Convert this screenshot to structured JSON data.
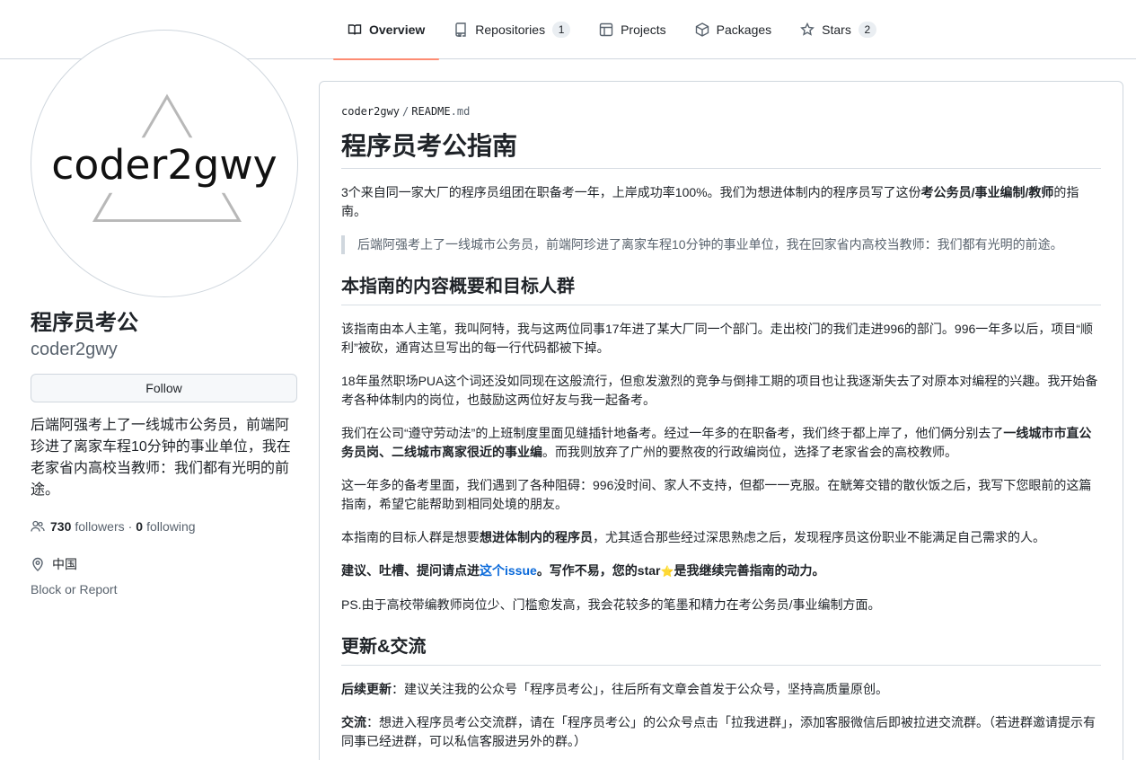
{
  "nav": {
    "tabs": [
      {
        "label": "Overview",
        "counter": ""
      },
      {
        "label": "Repositories",
        "counter": "1"
      },
      {
        "label": "Projects",
        "counter": ""
      },
      {
        "label": "Packages",
        "counter": ""
      },
      {
        "label": "Stars",
        "counter": "2"
      }
    ]
  },
  "profile": {
    "avatar_text": "coder2gwy",
    "fullname": "程序员考公",
    "username": "coder2gwy",
    "follow_label": "Follow",
    "bio": "后端阿强考上了一线城市公务员，前端阿珍进了离家车程10分钟的事业单位，我在老家省内高校当教师：我们都有光明的前途。",
    "followers_count": "730",
    "followers_label": "followers",
    "dot": "·",
    "following_count": "0",
    "following_label": "following",
    "location": "中国",
    "block_label": "Block or Report"
  },
  "readme": {
    "crumb_user": "coder2gwy",
    "crumb_sep": "/",
    "crumb_file": "README",
    "crumb_ext": ".md",
    "title": "程序员考公指南",
    "intro_a": "3个来自同一家大厂的程序员组团在职备考一年，上岸成功率100%。我们为想进体制内的程序员写了这份",
    "intro_b": "考公务员/事业编制/教师",
    "intro_c": "的指南。",
    "quote": "后端阿强考上了一线城市公务员，前端阿珍进了离家车程10分钟的事业单位，我在回家省内高校当教师：我们都有光明的前途。",
    "h2_overview": "本指南的内容概要和目标人群",
    "p1": "该指南由本人主笔，我叫阿特，我与这两位同事17年进了某大厂同一个部门。走出校门的我们走进996的部门。996一年多以后，项目“顺利”被砍，通宵达旦写出的每一行代码都被下掉。",
    "p2": "18年虽然职场PUA这个词还没如同现在这般流行，但愈发激烈的竞争与倒排工期的项目也让我逐渐失去了对原本对编程的兴趣。我开始备考各种体制内的岗位，也鼓励这两位好友与我一起备考。",
    "p3_a": "我们在公司“遵守劳动法”的上班制度里面见缝插针地备考。经过一年多的在职备考，我们终于都上岸了，他们俩分别去了",
    "p3_b": "一线城市市直公务员岗、二线城市离家很近的事业编",
    "p3_c": "。而我则放弃了广州的要熬夜的行政编岗位，选择了老家省会的高校教师。",
    "p4": "这一年多的备考里面，我们遇到了各种阻碍：996没时间、家人不支持，但都一一克服。在觥筹交错的散伙饭之后，我写下您眼前的这篇指南，希望它能帮助到相同处境的朋友。",
    "p5_a": "本指南的目标人群是想要",
    "p5_b": "想进体制内的程序员",
    "p5_c": "，尤其适合那些经过深思熟虑之后，发现程序员这份职业不能满足自己需求的人。",
    "p6_a": "建议、吐槽、提问请点进",
    "p6_link": "这个issue",
    "p6_b": "。写作不易，您的star",
    "p6_star": "⭐",
    "p6_c": "是我继续完善指南的动力。",
    "p7": "PS.由于高校带编教师岗位少、门槛愈发高，我会花较多的笔墨和精力在考公务员/事业编制方面。",
    "h2_update": "更新&交流",
    "p8_a": "后续更新",
    "p8_b": "：建议关注我的公众号「程序员考公」，往后所有文章会首发于公众号，坚持高质量原创。",
    "p9_a": "交流",
    "p9_b": "：想进入程序员考公交流群，请在「程序员考公」的公众号点击「拉我进群」，添加客服微信后即被拉进交流群。（若进群邀请提示有同事已经进群，可以私信客服进另外的群。）"
  }
}
